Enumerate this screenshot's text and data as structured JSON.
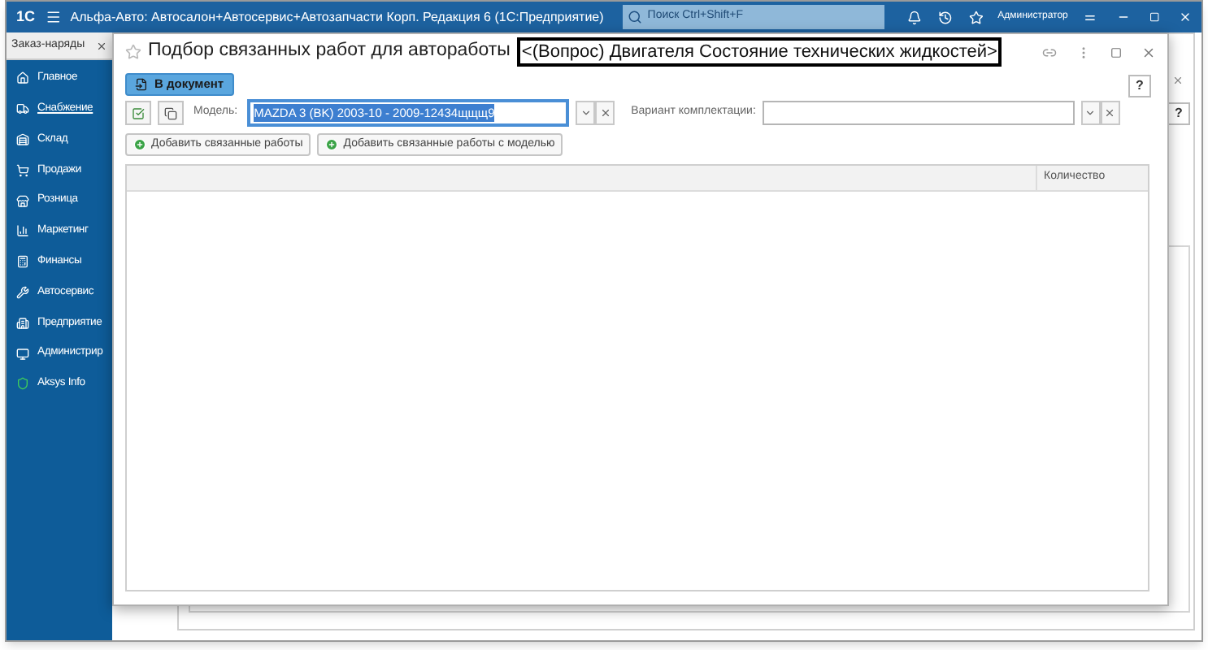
{
  "app": {
    "logo": "1С",
    "title": "Альфа-Авто: Автосалон+Автосервис+Автозапчасти Корп. Редакция 6  (1С:Предприятие)",
    "search": {
      "placeholder": "Поиск Ctrl+Shift+F"
    },
    "user": "Администратор"
  },
  "open_tab": {
    "label": "Заказ-наряды"
  },
  "sidebar": {
    "items": [
      {
        "label": "Главное",
        "selected": false
      },
      {
        "label": "Снабжение",
        "selected": true
      },
      {
        "label": "Склад",
        "selected": false
      },
      {
        "label": "Продажи",
        "selected": false
      },
      {
        "label": "Розница",
        "selected": false
      },
      {
        "label": "Маркетинг",
        "selected": false
      },
      {
        "label": "Финансы",
        "selected": false
      },
      {
        "label": "Автосервис",
        "selected": false
      },
      {
        "label": "Предприятие",
        "selected": false
      },
      {
        "label": "Администрир",
        "selected": false
      },
      {
        "label": "Aksys Info",
        "selected": false
      }
    ]
  },
  "background_form": {
    "help": "?"
  },
  "dialog": {
    "title": "Подбор связанных работ для автоработы",
    "highlight": "<(Вопрос) Двигателя Состояние технических жидкостей>",
    "to_document": "В документ",
    "help": "?",
    "model": {
      "label": "Модель:",
      "value": "MAZDA 3 (BK) 2003-10 - 2009-12434щщщ9",
      "text_selected": true
    },
    "variant": {
      "label": "Вариант комплектации:"
    },
    "buttons": [
      "Добавить связанные работы",
      "Добавить связанные работы с моделью"
    ],
    "table": {
      "columns": [
        "Количество"
      ]
    }
  }
}
